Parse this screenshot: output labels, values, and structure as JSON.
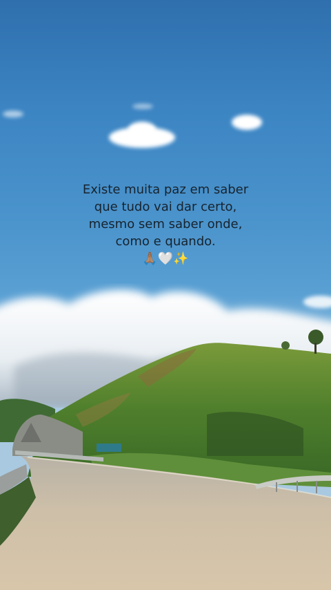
{
  "quote": {
    "lines": [
      "Existe muita paz em saber",
      "que tudo vai dar certo,",
      "mesmo sem saber onde,",
      "como e quando."
    ],
    "emojis": "🙏🏽🤍✨"
  }
}
